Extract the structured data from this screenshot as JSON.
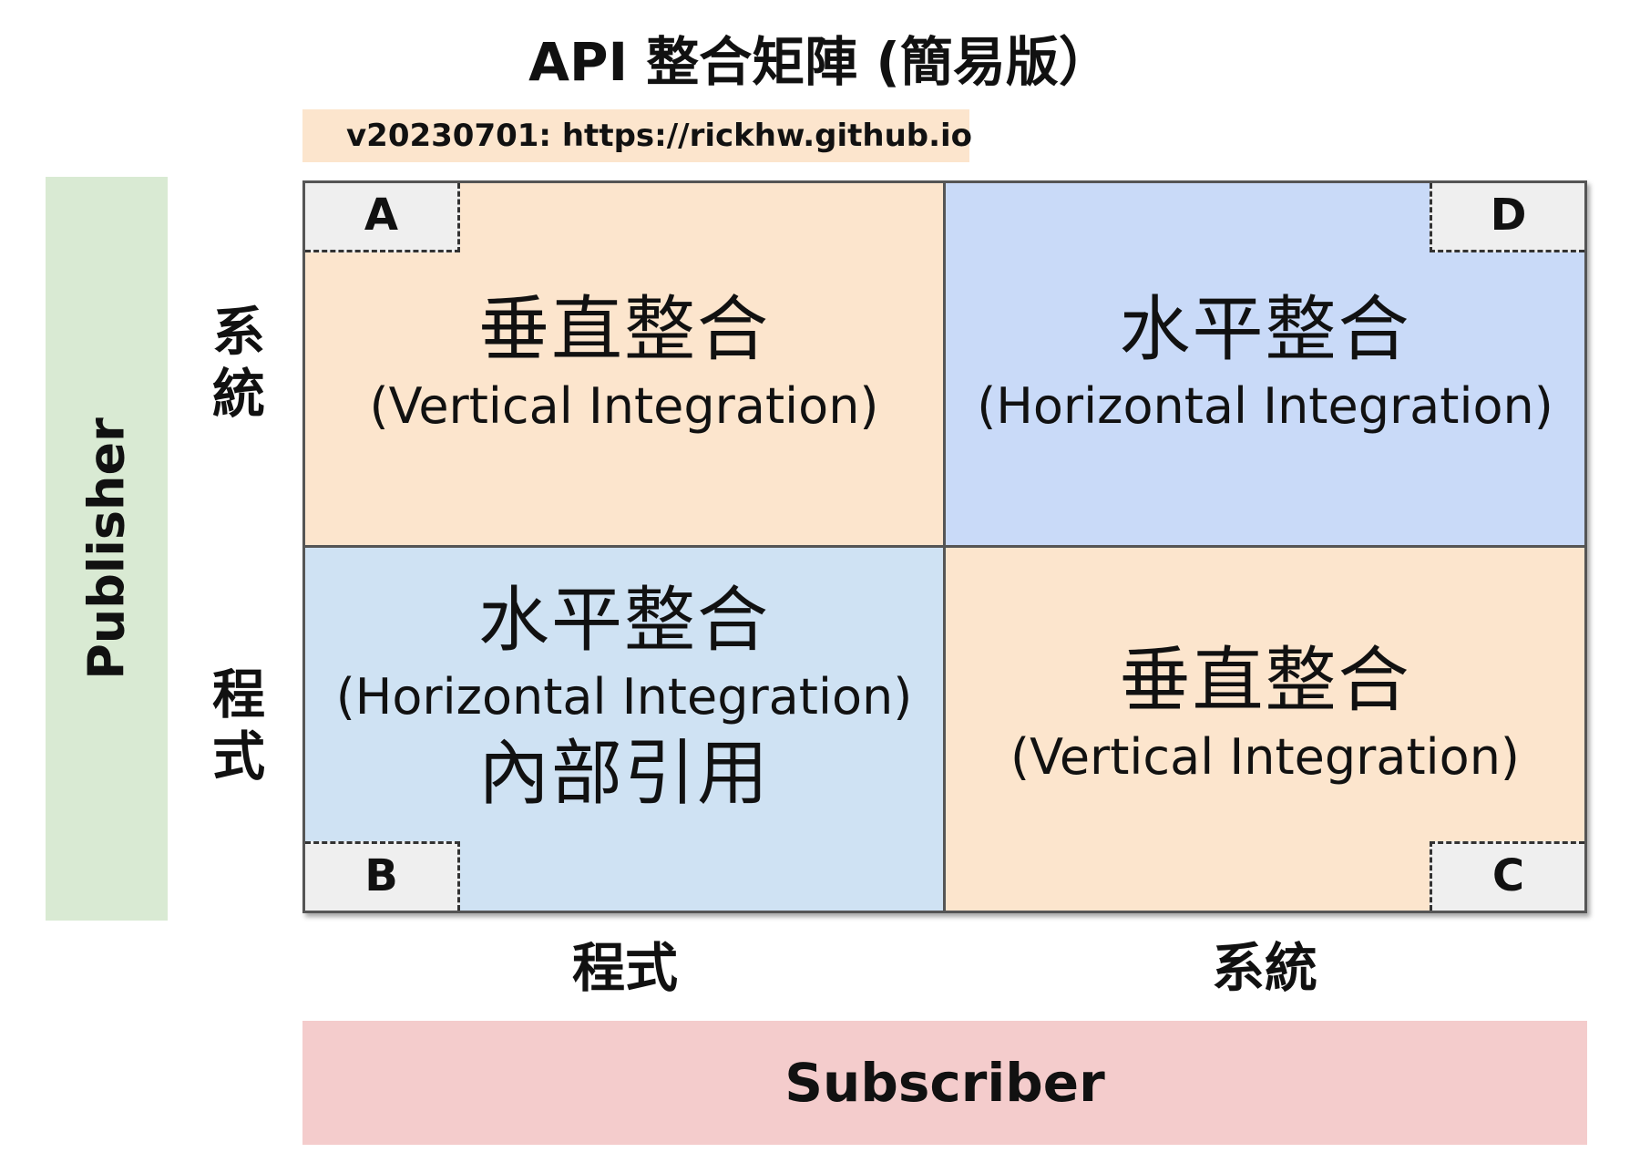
{
  "title": "API 整合矩陣 (簡易版）",
  "version": "v20230701: https://rickhw.github.io",
  "publisher": "Publisher",
  "subscriber": "Subscriber",
  "row_labels": {
    "top": [
      "系",
      "統"
    ],
    "bottom": [
      "程",
      "式"
    ]
  },
  "col_labels": {
    "left": "程式",
    "right": "系統"
  },
  "quadrants": {
    "A": {
      "tag": "A",
      "zh": "垂直整合",
      "en": "(Vertical Integration)",
      "extra": ""
    },
    "D": {
      "tag": "D",
      "zh": "水平整合",
      "en": "(Horizontal Integration)",
      "extra": ""
    },
    "B": {
      "tag": "B",
      "zh": "水平整合",
      "en": "(Horizontal Integration)",
      "extra": "內部引用"
    },
    "C": {
      "tag": "C",
      "zh": "垂直整合",
      "en": "(Vertical Integration)",
      "extra": ""
    }
  },
  "colors": {
    "vertical": "#fce5cd",
    "horizontal_system": "#c9daf8",
    "horizontal_program": "#cfe2f3",
    "publisher": "#d9ead3",
    "subscriber": "#f4cccc"
  }
}
